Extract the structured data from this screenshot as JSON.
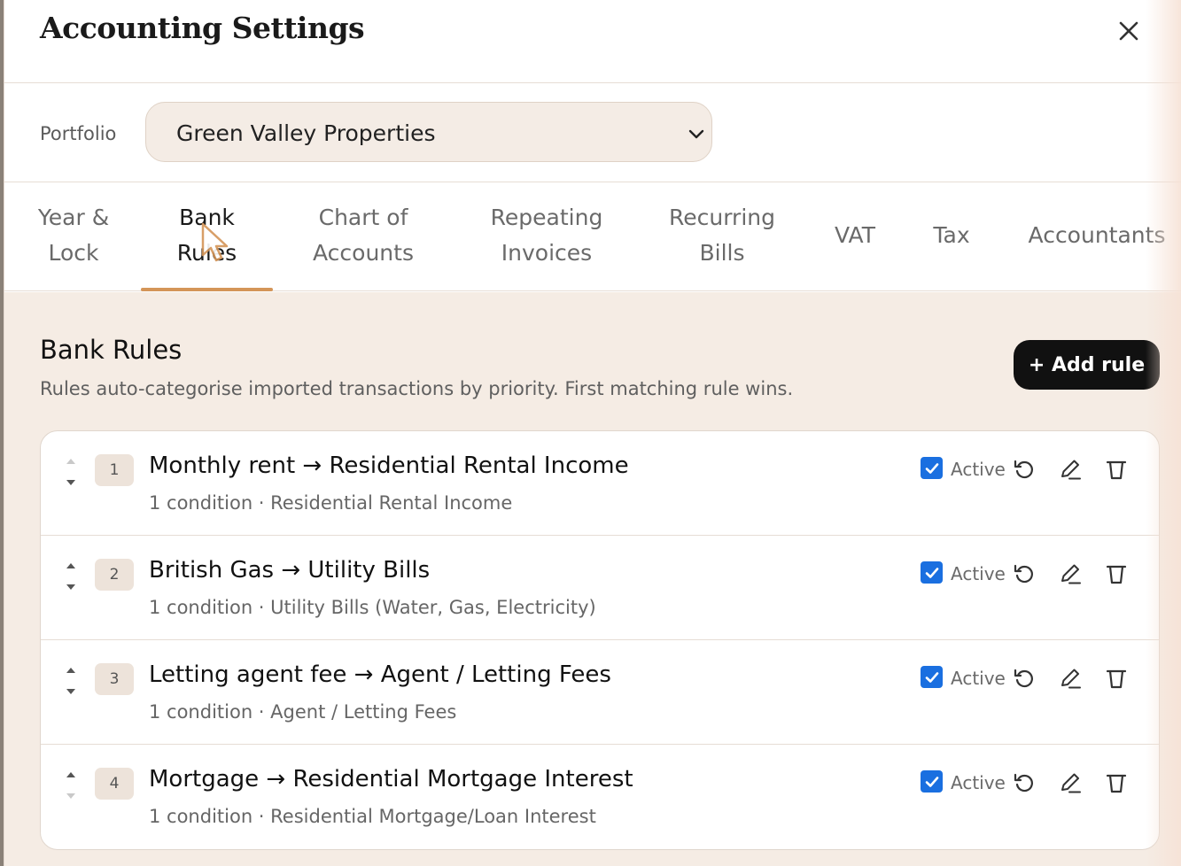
{
  "window": {
    "title": "Accounting Settings",
    "close_icon": "close-icon"
  },
  "portfolio": {
    "label": "Portfolio",
    "selected": "Green Valley Properties"
  },
  "tabs": [
    {
      "line1": "Year &",
      "line2": "Lock"
    },
    {
      "line1": "Bank",
      "line2": "Rules"
    },
    {
      "line1": "Chart of",
      "line2": "Accounts"
    },
    {
      "line1": "Repeating",
      "line2": "Invoices"
    },
    {
      "line1": "Recurring",
      "line2": "Bills"
    },
    {
      "line1": "VAT"
    },
    {
      "line1": "Tax"
    },
    {
      "line1": "Accountants"
    }
  ],
  "active_tab": "Bank Rules",
  "section": {
    "title": "Bank Rules",
    "subtitle": "Rules auto-categorise imported transactions by priority. First matching rule wins.",
    "add_button": "+ Add rule"
  },
  "rules": [
    {
      "priority": "1",
      "title": "Monthly rent → Residential Rental Income",
      "subtitle": "1 condition · Residential Rental Income",
      "active_label": "Active",
      "active": true
    },
    {
      "priority": "2",
      "title": "British Gas → Utility Bills",
      "subtitle": "1 condition · Utility Bills (Water, Gas, Electricity)",
      "active_label": "Active",
      "active": true
    },
    {
      "priority": "3",
      "title": "Letting agent fee → Agent / Letting Fees",
      "subtitle": "1 condition · Agent / Letting Fees",
      "active_label": "Active",
      "active": true
    },
    {
      "priority": "4",
      "title": "Mortgage → Residential Mortgage Interest",
      "subtitle": "1 condition · Residential Mortgage/Loan Interest",
      "active_label": "Active",
      "active": true
    }
  ],
  "colors": {
    "accent_underline": "#d49558",
    "checkbox": "#1a6fe0",
    "primary_button": "#111111",
    "content_bg": "#f5ece4"
  }
}
